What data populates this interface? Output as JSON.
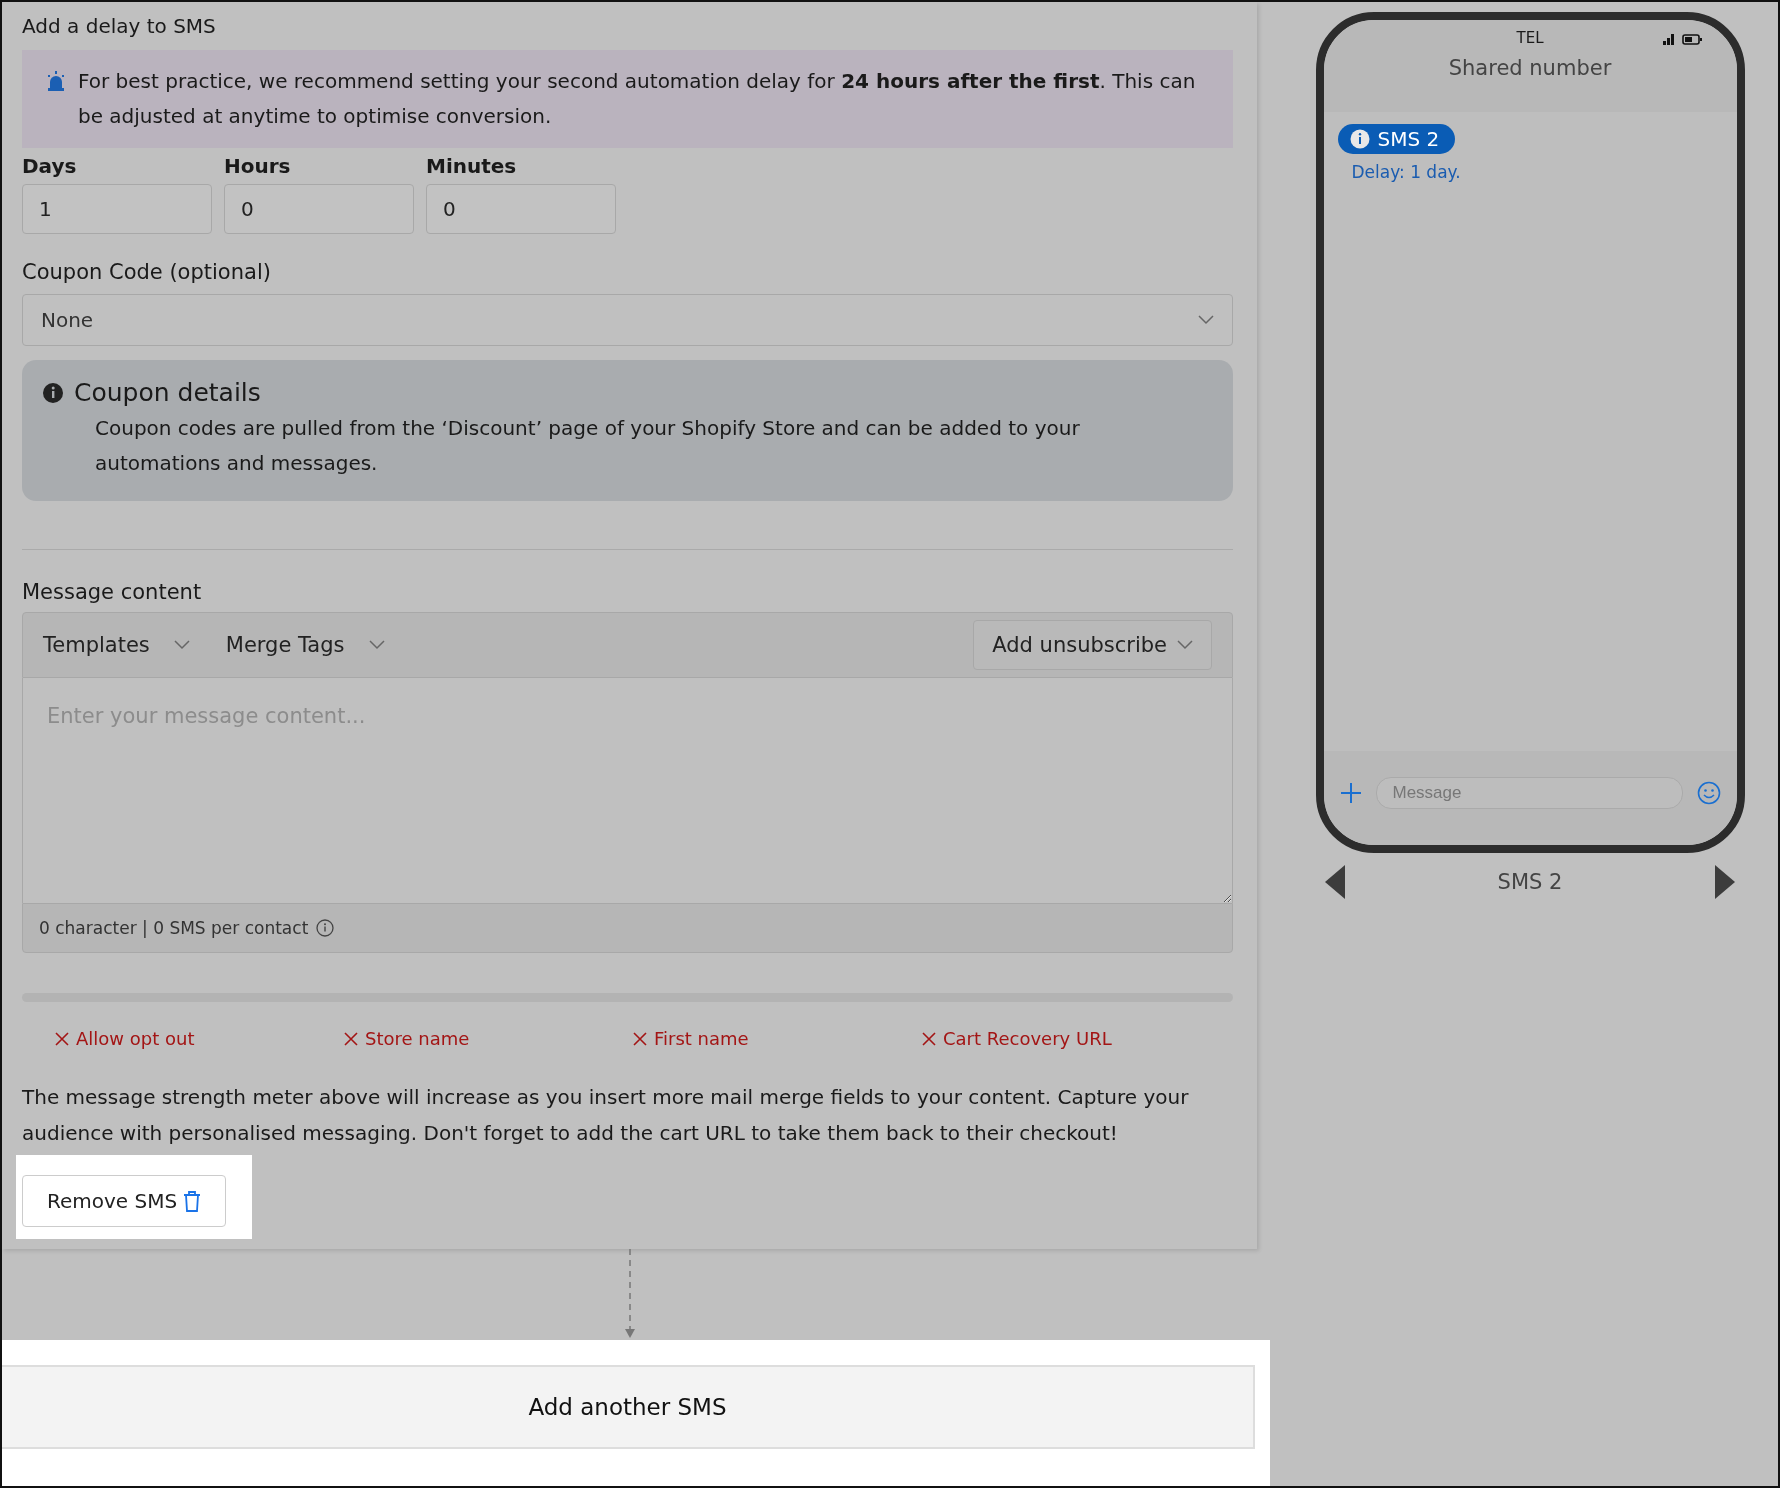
{
  "section_title": "Add a delay to SMS",
  "tip": {
    "text": "For best practice, we recommend setting your second automation delay for **24 hours after the first**. This can be adjusted at anytime to optimise conversion."
  },
  "delay_fields": [
    {
      "label": "Days",
      "value": "1"
    },
    {
      "label": "Hours",
      "value": "0"
    },
    {
      "label": "Minutes",
      "value": "0"
    }
  ],
  "coupon": {
    "label": "Coupon Code (optional)",
    "value": "None"
  },
  "coupon_details": {
    "title": "Coupon details",
    "text": "Coupon codes are pulled from the ‘Discount’ page of your Shopify Store and can be added to your automations and messages."
  },
  "message": {
    "label": "Message content",
    "menus": [
      "Templates",
      "Merge Tags"
    ],
    "unsubscribe": "Add unsubscribe",
    "placeholder": "Enter your message content...",
    "counter": "0 character | 0 SMS per contact"
  },
  "strength": {
    "level": 0,
    "checks": [
      {
        "label": "Allow opt out",
        "passed": false
      },
      {
        "label": "Store name",
        "passed": false
      },
      {
        "label": "First name",
        "passed": false
      },
      {
        "label": "Cart Recovery URL",
        "passed": false
      }
    ]
  },
  "help_text": "The message strength meter above will increase as you insert more mail merge fields to your content. Capture your audience with personalised messaging. Don't forget to add the cart URL to take them back to their checkout!",
  "remove_button": {
    "label": "Remove SMS",
    "highlighted": true
  },
  "add_button": {
    "label": "Add another SMS",
    "highlighted": true
  },
  "preview": {
    "carrier": "TEL",
    "header": "Shared number",
    "badge": "SMS 2",
    "delay": "Delay: 1 day.",
    "input_placeholder": "Message",
    "nav_label": "SMS 2"
  }
}
